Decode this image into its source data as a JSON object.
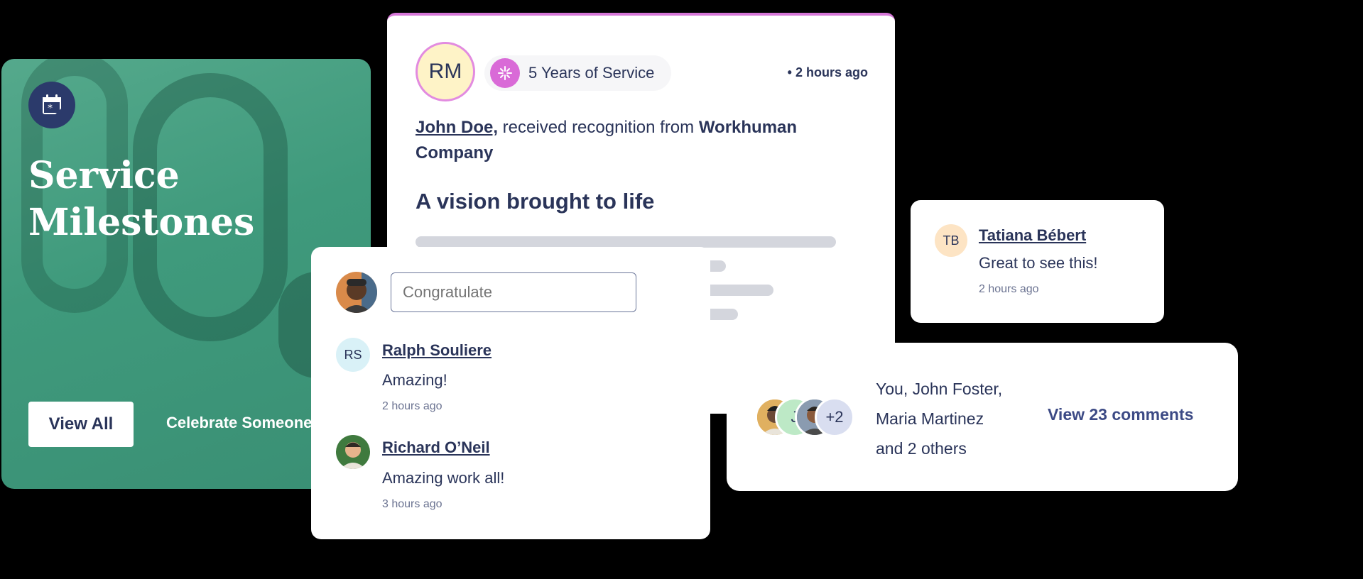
{
  "milestone": {
    "title_line1": "Service",
    "title_line2": "Milestones",
    "view_all": "View All",
    "celebrate": "Celebrate Someone"
  },
  "recognition": {
    "avatar_initials": "RM",
    "chip_label": "5 Years of Service",
    "time": "• 2 hours ago",
    "recipient": "John Doe,",
    "middle_text": " received recognition from ",
    "giver": "Workhuman Company",
    "award_title": "A vision brought to life"
  },
  "congrats": {
    "input_placeholder": "Congratulate",
    "comments": [
      {
        "initials": "RS",
        "name": "Ralph Souliere",
        "text": "Amazing!",
        "time": "2 hours ago"
      },
      {
        "initials": "",
        "name": "Richard O’Neil",
        "text": "Amazing work all!",
        "time": "3 hours ago"
      }
    ]
  },
  "tatiana": {
    "initials": "TB",
    "name": "Tatiana Bébert",
    "text": "Great to see this!",
    "time": "2 hours ago"
  },
  "likes": {
    "avatar_j": "J",
    "more_count": "+2",
    "line1": "You, John Foster,",
    "line2": "Maria Martinez",
    "line3": "and 2 others",
    "view_comments": "View 23 comments"
  },
  "colors": {
    "navy": "#2a3459",
    "green": "#3f9a7c",
    "pink": "#d677d8"
  }
}
